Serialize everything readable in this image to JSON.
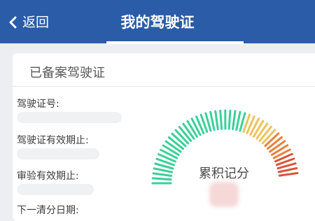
{
  "nav": {
    "back_label": "返回",
    "title": "我的驾驶证"
  },
  "card": {
    "header": "已备案驾驶证",
    "fields": [
      {
        "label": "驾驶证号:",
        "value": "••••••••••••••"
      },
      {
        "label": "驾驶证有效期止:",
        "value": "••••••••••"
      },
      {
        "label": "审验有效期止:",
        "value": "••••••••••"
      },
      {
        "label": "下一清分日期:",
        "value": ""
      }
    ]
  },
  "gauge": {
    "label": "累积记分",
    "value": ""
  },
  "colors": {
    "nav_bg": "#2b5ca8",
    "gauge_green": "#3ccf9b",
    "gauge_yellow": "#ecc25a",
    "gauge_orange": "#e6823c",
    "gauge_red": "#d9543a"
  }
}
